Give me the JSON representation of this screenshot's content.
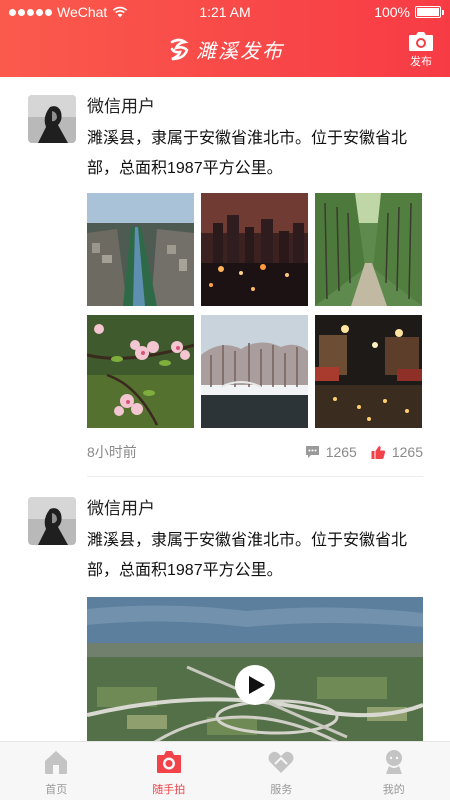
{
  "status_bar": {
    "carrier": "WeChat",
    "time": "1:21 AM",
    "battery": "100%"
  },
  "header": {
    "title": "濉溪发布",
    "publish_label": "发布"
  },
  "posts": [
    {
      "username": "微信用户",
      "text": "濉溪县，隶属于安徽省淮北市。位于安徽省北部，总面积1987平方公里。",
      "time_ago": "8小时前",
      "comments": "1265",
      "likes": "1265",
      "images": [
        "river-aerial",
        "city-night",
        "tree-avenue",
        "blossoms",
        "winter-lake",
        "night-market"
      ]
    },
    {
      "username": "微信用户",
      "text": "濉溪县，隶属于安徽省淮北市。位于安徽省北部，总面积1987平方公里。",
      "video": "highway-interchange-aerial"
    }
  ],
  "tabs": [
    {
      "label": "首页",
      "icon": "home-icon",
      "active": false
    },
    {
      "label": "随手拍",
      "icon": "camera-icon",
      "active": true
    },
    {
      "label": "服务",
      "icon": "heart-hands-icon",
      "active": false
    },
    {
      "label": "我的",
      "icon": "person-icon",
      "active": false
    }
  ],
  "colors": {
    "brand_red": "#f73b45",
    "active_tab": "#f2424a",
    "inactive_tab": "#bbbbbb",
    "like_red": "#f2424a"
  }
}
